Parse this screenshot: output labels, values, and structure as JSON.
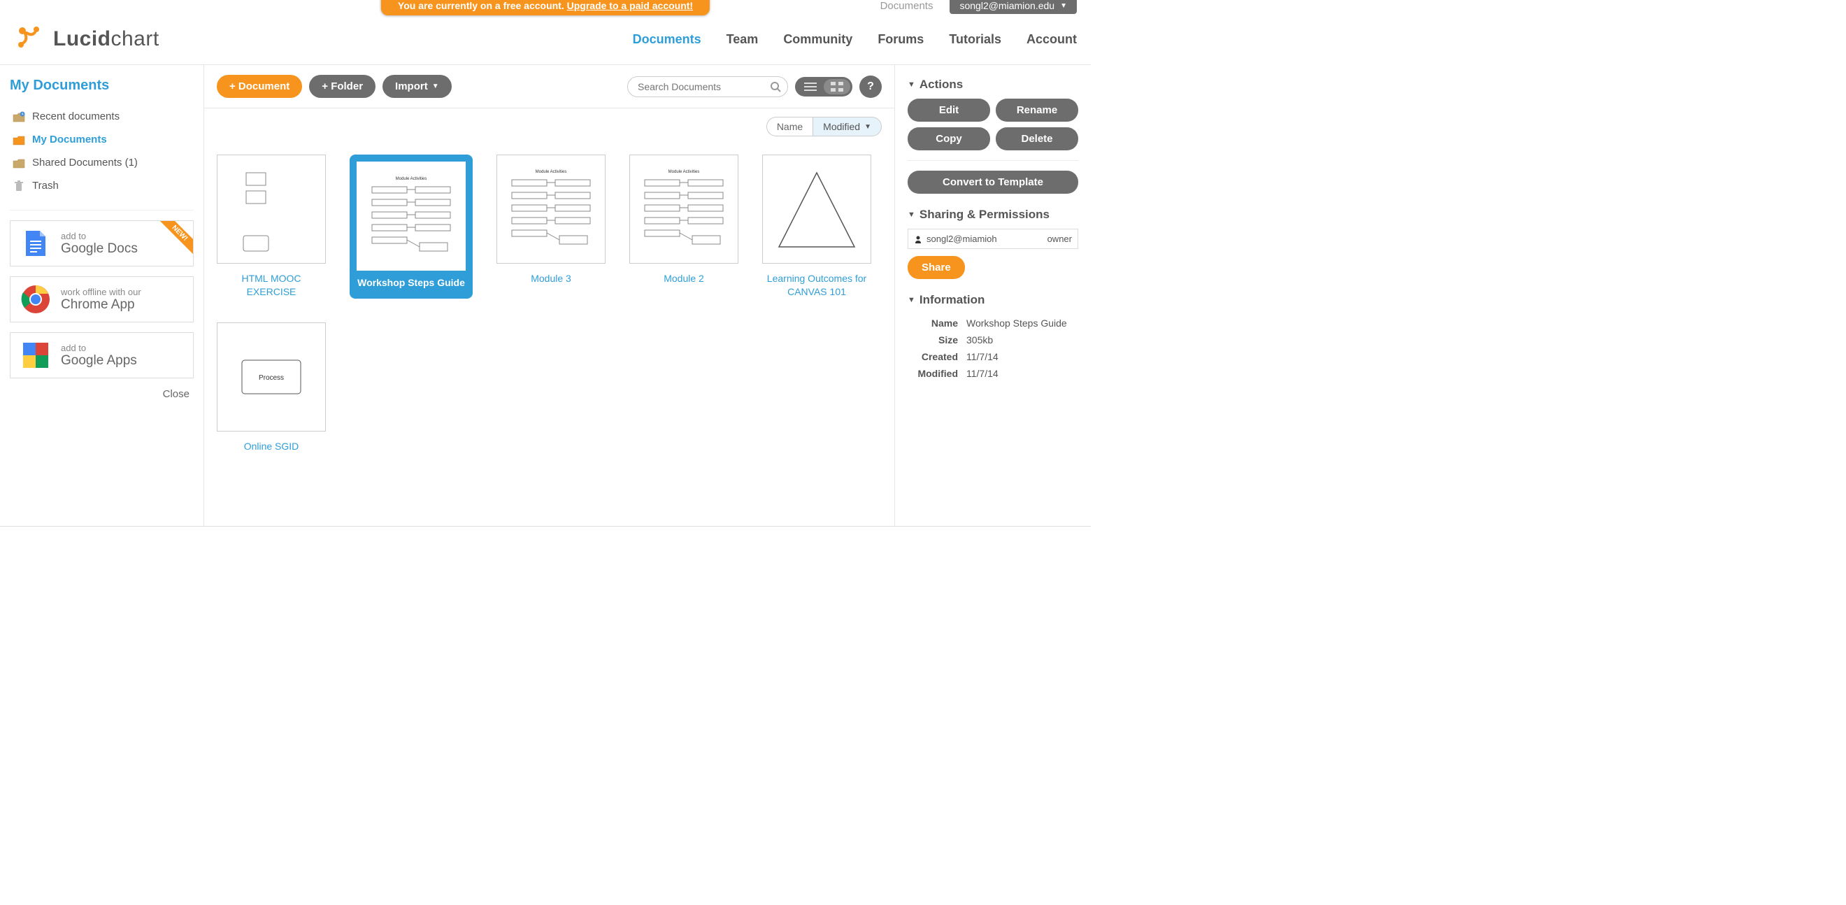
{
  "banner": {
    "prefix": "You are currently on a free account. ",
    "link": "Upgrade to a paid account!"
  },
  "top": {
    "docs_link": "Documents",
    "user_email": "songl2@miamion.edu"
  },
  "logo": {
    "bold": "Lucid",
    "light": "chart"
  },
  "nav": [
    {
      "label": "Documents",
      "active": true
    },
    {
      "label": "Team"
    },
    {
      "label": "Community"
    },
    {
      "label": "Forums"
    },
    {
      "label": "Tutorials"
    },
    {
      "label": "Account"
    }
  ],
  "sidebar": {
    "title": "My Documents",
    "items": [
      {
        "label": "Recent documents",
        "icon": "recent"
      },
      {
        "label": "My Documents",
        "icon": "folder",
        "active": true
      },
      {
        "label": "Shared Documents (1)",
        "icon": "folder"
      },
      {
        "label": "Trash",
        "icon": "trash"
      }
    ],
    "promos": [
      {
        "small": "add to",
        "big": "Google Docs",
        "icon": "gdocs",
        "new": true
      },
      {
        "small": "work offline with our",
        "big": "Chrome App",
        "icon": "chrome"
      },
      {
        "small": "add to",
        "big": "Google Apps",
        "icon": "gapps"
      }
    ],
    "close": "Close"
  },
  "toolbar": {
    "new_doc": "+ Document",
    "new_folder": "+ Folder",
    "import": "Import",
    "search_placeholder": "Search Documents",
    "help": "?"
  },
  "sort": {
    "name": "Name",
    "modified": "Modified"
  },
  "documents": [
    {
      "title": "HTML MOOC EXERCISE",
      "thumb": "boxes"
    },
    {
      "title": "Workshop Steps Guide",
      "thumb": "flowchart",
      "selected": true
    },
    {
      "title": "Module 3",
      "thumb": "flowchart"
    },
    {
      "title": "Module 2",
      "thumb": "flowchart"
    },
    {
      "title": "Learning Outcomes for CANVAS 101",
      "thumb": "triangle"
    },
    {
      "title": "Online SGID",
      "thumb": "process"
    }
  ],
  "panel": {
    "actions_head": "Actions",
    "edit": "Edit",
    "rename": "Rename",
    "copy": "Copy",
    "delete": "Delete",
    "convert": "Convert to Template",
    "sharing_head": "Sharing & Permissions",
    "perm_user": "songl2@miamioh",
    "perm_role": "owner",
    "share": "Share",
    "info_head": "Information",
    "info": {
      "name_k": "Name",
      "name_v": "Workshop Steps Guide",
      "size_k": "Size",
      "size_v": "305kb",
      "created_k": "Created",
      "created_v": "11/7/14",
      "modified_k": "Modified",
      "modified_v": "11/7/14"
    }
  }
}
